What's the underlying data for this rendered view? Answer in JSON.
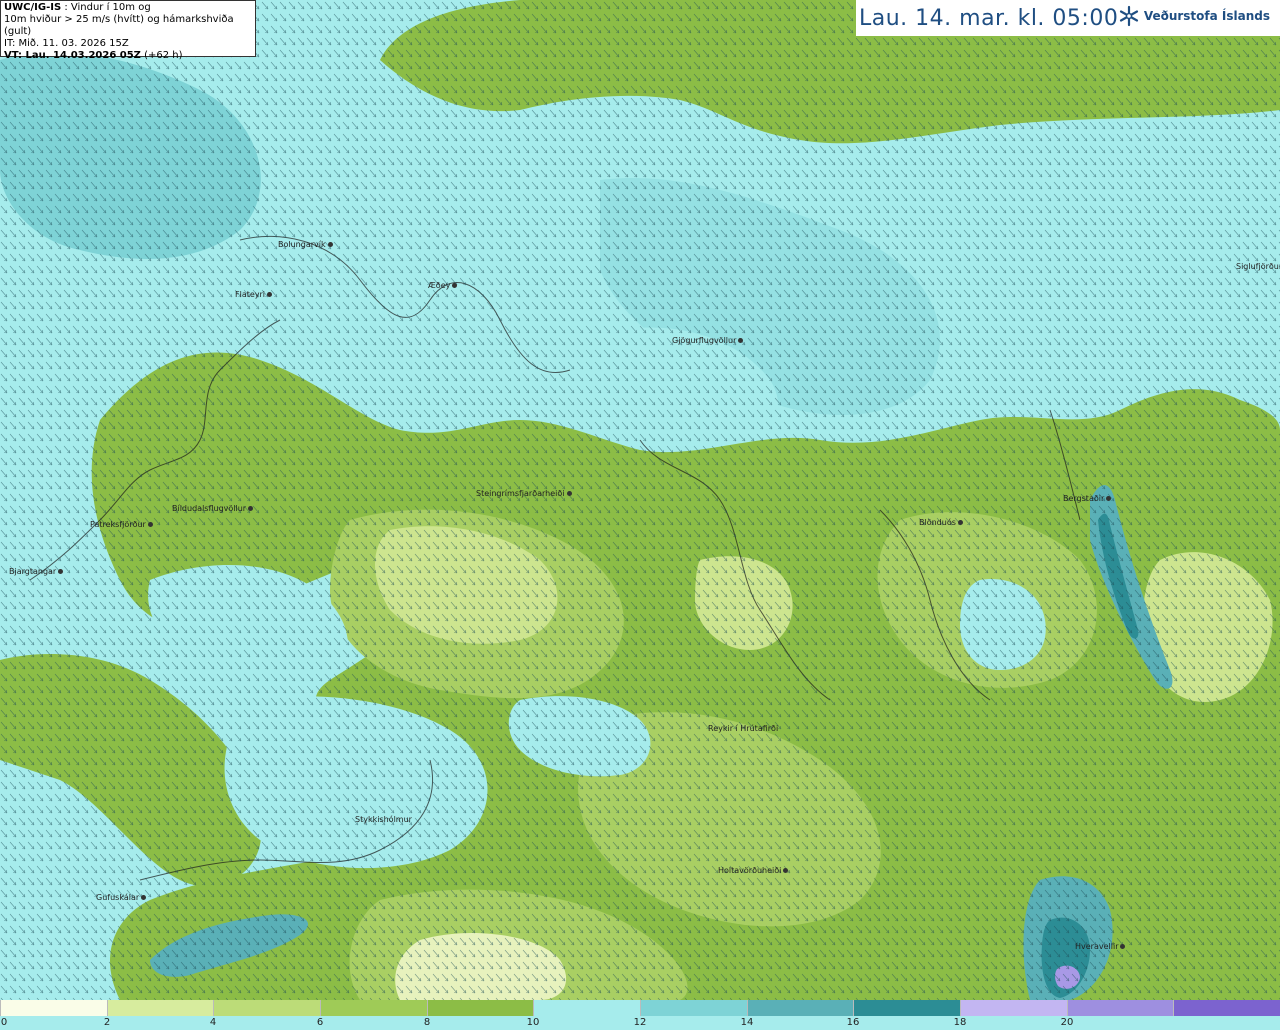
{
  "info": {
    "model": "UWC/IG-IS",
    "desc1": " : Vindur í 10m og",
    "desc2": "10m hviður > 25 m/s (hvítt) og hámarkshviða (gult)",
    "init": "IT: Mið. 11. 03. 2026 15Z",
    "valid": "VT: Lau. 14.03.2026 05Z",
    "lead": "(+62 h)"
  },
  "time_label": "Lau. 14. mar. kl. 05:00",
  "logo": {
    "text": "Veðurstofa Íslands",
    "icon": "snowflake-logo-icon"
  },
  "map_colors": {
    "ocean": "#a6ecec",
    "sea_deep": "#7ed3d6",
    "sea_mid": "#95e1e3",
    "land_green": "#8cbd46",
    "land_mid": "#a9cf63",
    "land_light": "#cde58f",
    "land_pale": "#e7f2bd",
    "gust": "#5ab0b7",
    "gust_dark": "#2c8d95",
    "purple": "#a899e6"
  },
  "places": [
    "Bolungarvík",
    "Æðey",
    "Flateyri",
    "Gjögurflugvöllur",
    "Siglufjörður",
    "Steingrímsfjarðarheiði",
    "Patreksfjörður",
    "Bíldudalsflugvöllur",
    "Bjargtangar",
    "Blönduós",
    "Bergstaðir",
    "Reykir í Hrútafirði",
    "Stykkishólmur",
    "Holtavörðuheiði",
    "Gufuskálar",
    "Hveravellir"
  ],
  "legend": {
    "colors": [
      "#fafde8",
      "#d7ec9e",
      "#bcdc78",
      "#9fcb57",
      "#8cbd46",
      "#a6ecec",
      "#7ed3d6",
      "#5ab0b7",
      "#2c8d95",
      "#c3b6f2",
      "#9e8fe0",
      "#7c63cf"
    ],
    "ticks": [
      "0",
      "2",
      "4",
      "6",
      "8",
      "10",
      "12",
      "14",
      "16",
      "18",
      "20"
    ]
  }
}
